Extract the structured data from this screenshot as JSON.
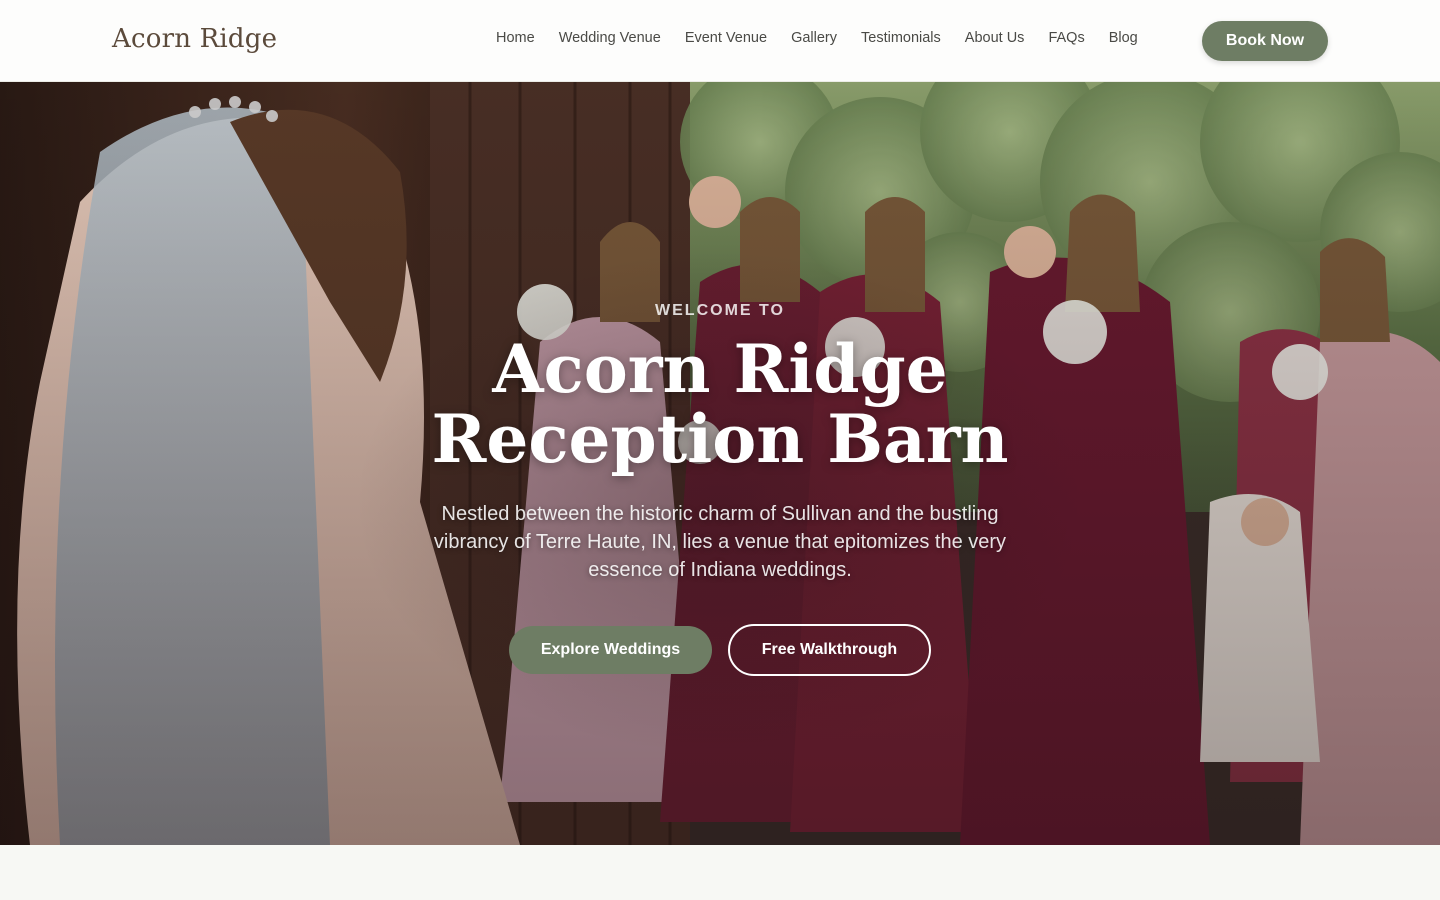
{
  "header": {
    "logo": "Acorn Ridge",
    "nav": [
      "Home",
      "Wedding Venue",
      "Event Venue",
      "Gallery",
      "Testimonials",
      "About Us",
      "FAQs",
      "Blog"
    ],
    "book_label": "Book Now"
  },
  "hero": {
    "eyebrow": "WELCOME TO",
    "title_line1": "Acorn Ridge",
    "title_line2": "Reception Barn",
    "subtitle": "Nestled between the historic charm of Sullivan and the bustling vibrancy of Terre Haute, IN, lies a venue that epitomizes the very essence of Indiana weddings.",
    "primary_cta": "Explore Weddings",
    "secondary_cta": "Free Walkthrough"
  },
  "colors": {
    "accent": "#6e7d64",
    "logo": "#5b4a3b",
    "page_bg": "#f7f8f4"
  }
}
